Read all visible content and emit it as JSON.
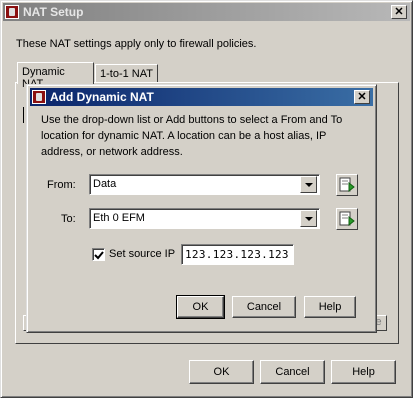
{
  "outer": {
    "title": "NAT Setup",
    "intro": "These NAT settings apply only to firewall policies.",
    "tabs": [
      {
        "label": "Dynamic NAT"
      },
      {
        "label": "1-to-1 NAT"
      }
    ],
    "ok_label": "OK",
    "cancel_label": "Cancel",
    "help_label": "Help"
  },
  "dialog": {
    "title": "Add Dynamic NAT",
    "description": "Use the drop-down list or Add buttons to select a From and To location for dynamic NAT. A location can be a host alias, IP address, or network address.",
    "from_label": "From:",
    "from_value": "Data",
    "to_label": "To:",
    "to_value": "Eth 0 EFM",
    "set_source_ip_label": "Set source IP",
    "set_source_ip_checked": true,
    "source_ip_value": "123.123.123.123",
    "ok_label": "OK",
    "cancel_label": "Cancel",
    "help_label": "Help"
  },
  "icons": {
    "window": "firewall-app-icon",
    "close": "close-icon",
    "add": "add-location-icon",
    "dropdown": "chevron-down-icon"
  }
}
